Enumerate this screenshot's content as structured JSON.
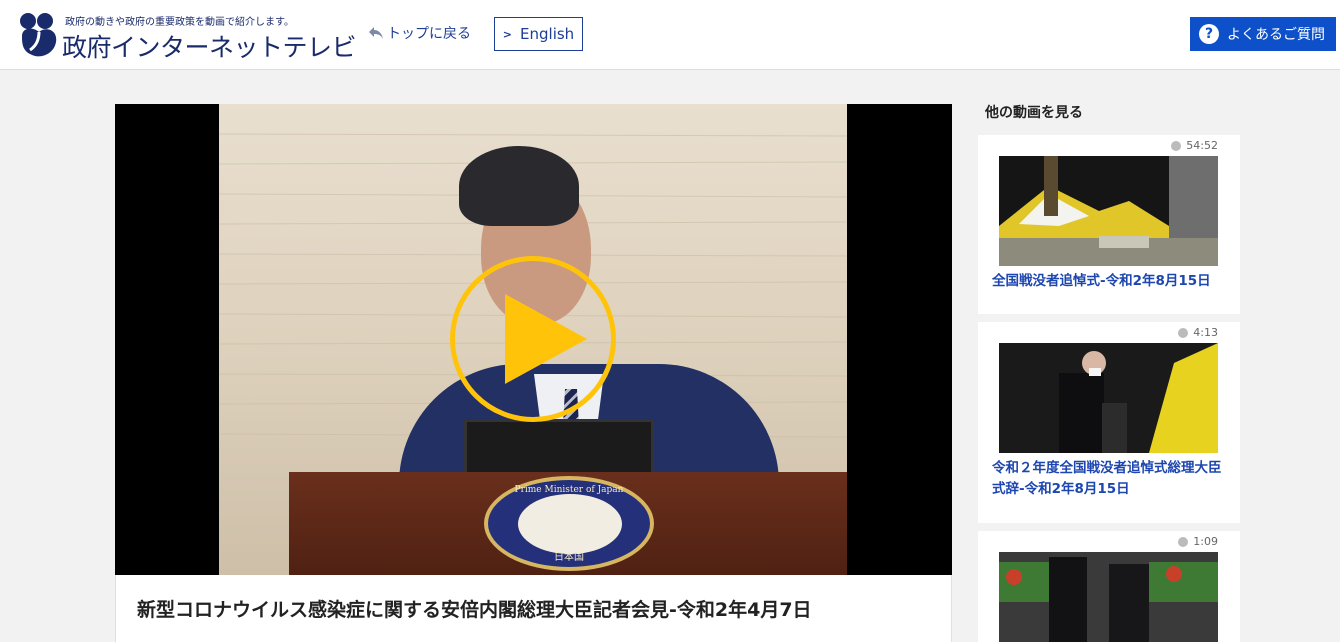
{
  "header": {
    "tagline": "政府の動きや政府の重要政策を動画で紹介します。",
    "site_name": "政府インターネットテレビ",
    "back_label": "トップに戻る",
    "english_label": "English",
    "faq_label": "よくあるご質問"
  },
  "player": {
    "seal_top": "Prime Minister of Japan",
    "seal_bottom": "日本国"
  },
  "video": {
    "title": "新型コロナウイルス感染症に関する安倍内閣総理大臣記者会見-令和2年4月7日"
  },
  "sidebar": {
    "heading": "他の動画を見る",
    "items": [
      {
        "duration": "54:52",
        "title": "全国戦没者追悼式-令和2年8月15日"
      },
      {
        "duration": "4:13",
        "title": "令和２年度全国戦没者追悼式総理大臣式辞-令和2年8月15日"
      },
      {
        "duration": "1:09",
        "title": ""
      }
    ]
  },
  "colors": {
    "brand_navy": "#1a2b6b",
    "faq_blue": "#0d50c9",
    "play_yellow": "#ffc40a",
    "link_blue": "#1d46b0"
  },
  "icons": [
    "logo-mark-icon",
    "back-arrow-icon",
    "chevron-right-icon",
    "question-icon",
    "play-icon",
    "clock-icon"
  ]
}
